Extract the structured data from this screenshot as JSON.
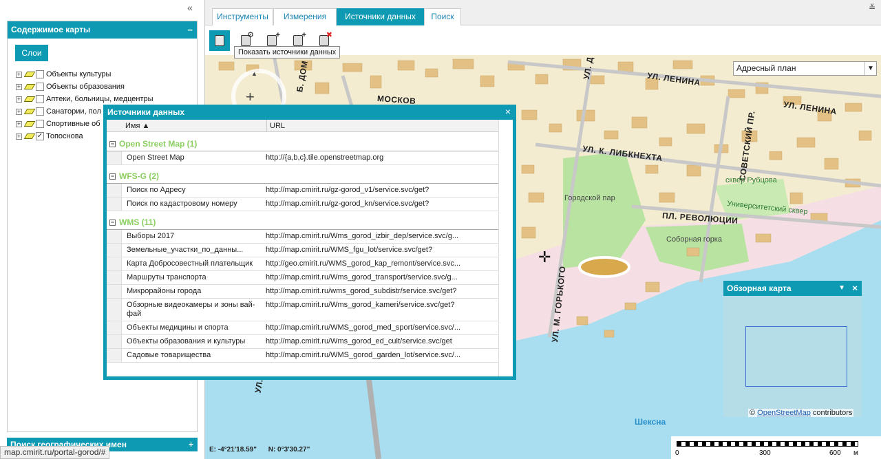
{
  "left_panel": {
    "collapse_glyph": "«",
    "map_contents": {
      "title": "Содержимое карты",
      "collapse_glyph": "−",
      "layers_button": "Слои",
      "layers": [
        {
          "label": "Объекты культуры",
          "checked": false
        },
        {
          "label": "Объекты образования",
          "checked": false
        },
        {
          "label": "Аптеки, больницы, медцентры",
          "checked": false
        },
        {
          "label": "Санатории, пол",
          "checked": false
        },
        {
          "label": "Спортивные об",
          "checked": false
        },
        {
          "label": "Топоснова",
          "checked": true
        }
      ]
    },
    "geo_names_panel": {
      "title": "Поиск географических имен",
      "expand_glyph": "+"
    }
  },
  "status_url": "map.cmirit.ru/portal-gorod/#",
  "tabs": [
    "Инструменты",
    "Измерения",
    "Источники данных",
    "Поиск"
  ],
  "active_tab": "Источники данных",
  "collapse_top_glyph": "≚",
  "toolbar": {
    "buttons": [
      {
        "icon": "data-sources-icon",
        "mini": ""
      },
      {
        "icon": "layer-settings-icon",
        "mini": "⚙"
      },
      {
        "icon": "add-source-icon",
        "mini": "+"
      },
      {
        "icon": "new-source-icon",
        "mini": "+"
      },
      {
        "icon": "remove-source-icon",
        "mini": "✖"
      }
    ],
    "tooltip": "Показать источники данных"
  },
  "map": {
    "basemap_select": "Адресный план",
    "select_arrow": "▼",
    "zoom_in_glyph": "+",
    "pan_up_glyph": "▲",
    "cursor_glyph": "✛",
    "streets": [
      {
        "text": "УЛ. ЛЕНИНА"
      },
      {
        "text": "УЛ. ЛЕНИНА"
      },
      {
        "text": "УЛ. К. ЛИБКНЕХТА"
      },
      {
        "text": "СОВЕТСКИЙ ПР."
      },
      {
        "text": "ПЛ. РЕВОЛЮЦИИ"
      },
      {
        "text": "УЛ. М. ГОРЬКОГО"
      },
      {
        "text": "УЛ. Д"
      },
      {
        "text": "Б. ДОМ"
      },
      {
        "text": "МОСКОВ"
      },
      {
        "text": "УЛ."
      }
    ],
    "places": [
      {
        "text": "сквер Рубцова"
      },
      {
        "text": "Городской пар"
      },
      {
        "text": "Университетский сквер"
      },
      {
        "text": "Соборная горка"
      }
    ],
    "river": "Шексна",
    "coords": {
      "e": "E: -4°21'18.59\"",
      "n": "N: 0°3'30.27\""
    },
    "scale": {
      "ticks": [
        "0",
        "300",
        "600"
      ],
      "unit": "м"
    }
  },
  "overview": {
    "title": "Обзорная карта",
    "menu_glyph": "▼",
    "close_glyph": "×",
    "attribution": {
      "symbol": "©",
      "link": "OpenStreetMap",
      "suffix": "contributors"
    }
  },
  "data_sources": {
    "title": "Источники данных",
    "close_glyph": "×",
    "columns": {
      "name": "Имя ▲",
      "url": "URL"
    },
    "groups": [
      {
        "toggle": "−",
        "title": "Open Street Map (1)",
        "rows": [
          {
            "name": "Open Street Map",
            "url": "http://{a,b,c}.tile.openstreetmap.org"
          }
        ]
      },
      {
        "toggle": "−",
        "title": "WFS-G (2)",
        "rows": [
          {
            "name": "Поиск по Адресу",
            "url": "http://map.cmirit.ru/gz-gorod_v1/service.svc/get?"
          },
          {
            "name": "Поиск по кадастровому номеру",
            "url": "http://map.cmirit.ru/gz-gorod_kn/service.svc/get?"
          }
        ]
      },
      {
        "toggle": "−",
        "title": "WMS (11)",
        "rows": [
          {
            "name": "Выборы 2017",
            "url": "http://map.cmirit.ru/Wms_gorod_izbir_dep/service.svc/g..."
          },
          {
            "name": "Земельные_участки_по_данны...",
            "url": "http://map.cmirit.ru/WMS_fgu_lot/service.svc/get?"
          },
          {
            "name": "Карта Добросовестный плательщик",
            "url": "http://geo.cmirit.ru/WMS_gorod_kap_remont/service.svc..."
          },
          {
            "name": "Маршруты транспорта",
            "url": "http://map.cmirit.ru/Wms_gorod_transport/service.svc/g..."
          },
          {
            "name": "Микрорайоны города",
            "url": "http://map.cmirit.ru/wms_gorod_subdistr/service.svc/get?"
          },
          {
            "name": "Обзорные видеокамеры и зоны вай-фай",
            "url": "http://map.cmirit.ru/Wms_gorod_kameri/service.svc/get?"
          },
          {
            "name": "Объекты медицины и спорта",
            "url": "http://map.cmirit.ru/WMS_gorod_med_sport/service.svc/..."
          },
          {
            "name": "Объекты образования и культуры",
            "url": "http://map.cmirit.ru/Wms_gorod_ed_cult/service.svc/get"
          },
          {
            "name": "Садовые товарищества",
            "url": "http://map.cmirit.ru/WMS_gorod_garden_lot/service.svc/..."
          }
        ]
      }
    ]
  }
}
